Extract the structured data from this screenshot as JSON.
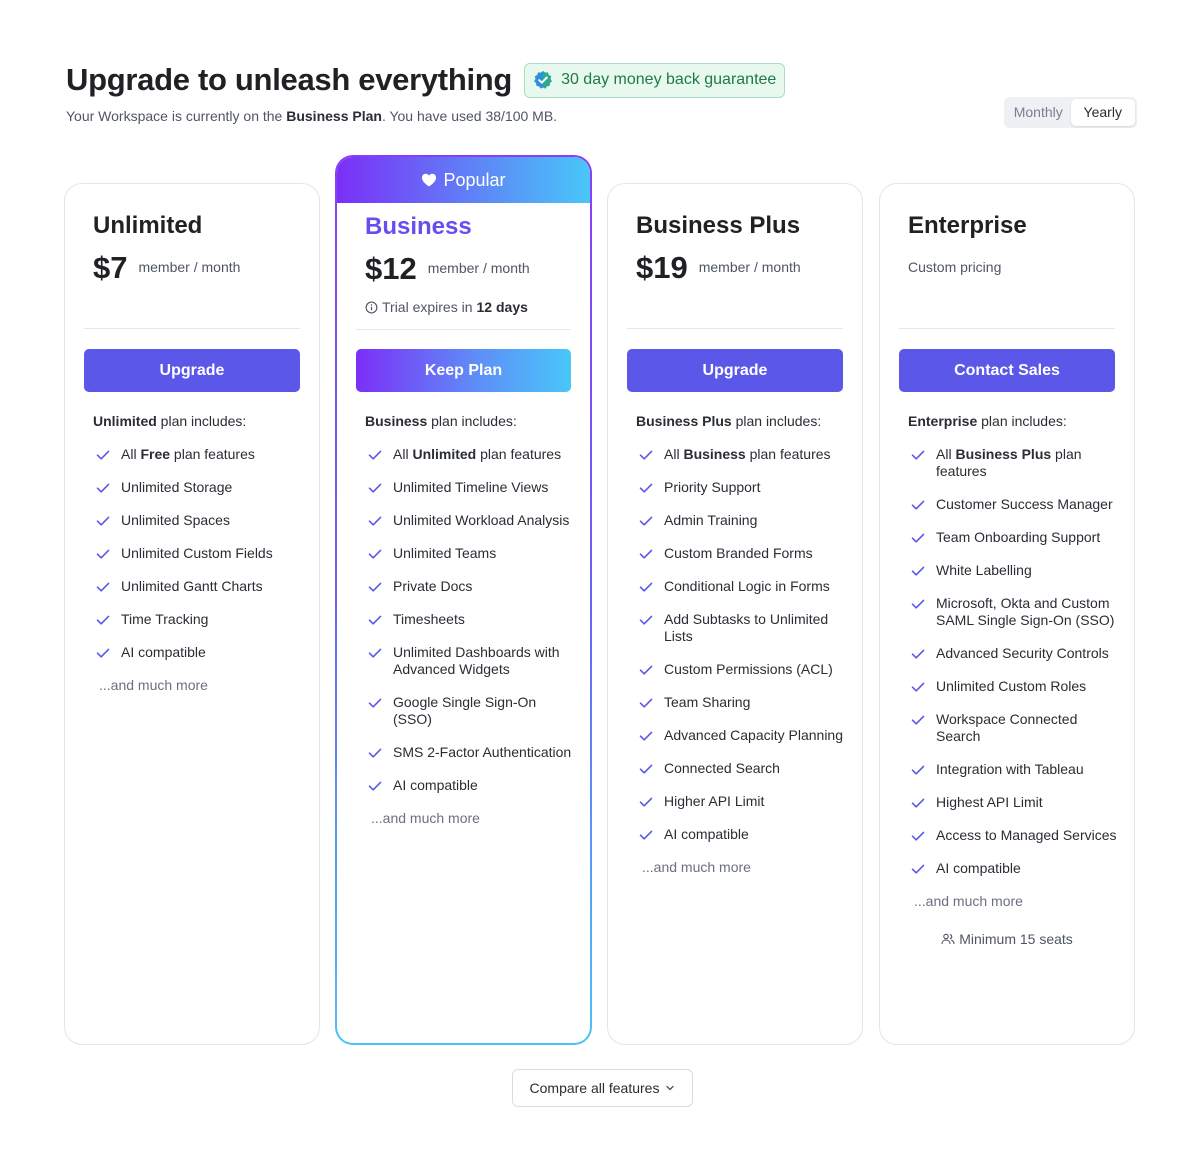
{
  "header": {
    "title": "Upgrade to unleash everything",
    "guarantee": "30 day money back guarantee",
    "subtitle_pre": "Your Workspace is currently on the ",
    "subtitle_plan": "Business Plan",
    "subtitle_post": ". You have used 38/100 MB."
  },
  "billing_toggle": {
    "monthly": "Monthly",
    "yearly": "Yearly",
    "selected": "Yearly"
  },
  "plans": [
    {
      "name": "Unlimited",
      "price": "$7",
      "per": "member / month",
      "button": "Upgrade",
      "includes_bold": "Unlimited",
      "includes_rest": " plan includes:",
      "features": [
        {
          "pre": "All ",
          "bold": "Free",
          "post": " plan features"
        },
        {
          "pre": "Unlimited Storage"
        },
        {
          "pre": "Unlimited Spaces"
        },
        {
          "pre": "Unlimited Custom Fields"
        },
        {
          "pre": "Unlimited Gantt Charts"
        },
        {
          "pre": "Time Tracking"
        },
        {
          "pre": "AI compatible"
        }
      ],
      "more": "...and much more"
    },
    {
      "name": "Business",
      "badge": "Popular",
      "price": "$12",
      "per": "member / month",
      "trial_pre": "Trial expires in",
      "trial_days": "12 days",
      "button": "Keep Plan",
      "includes_bold": "Business",
      "includes_rest": " plan includes:",
      "features": [
        {
          "pre": "All ",
          "bold": "Unlimited",
          "post": " plan features"
        },
        {
          "pre": "Unlimited Timeline Views"
        },
        {
          "pre": "Unlimited Workload Analysis"
        },
        {
          "pre": "Unlimited Teams"
        },
        {
          "pre": "Private Docs"
        },
        {
          "pre": "Timesheets"
        },
        {
          "pre": "Unlimited Dashboards with Advanced Widgets"
        },
        {
          "pre": "Google Single Sign-On (SSO)"
        },
        {
          "pre": "SMS 2-Factor Authentication"
        },
        {
          "pre": "AI compatible"
        }
      ],
      "more": "...and much more"
    },
    {
      "name": "Business Plus",
      "price": "$19",
      "per": "member / month",
      "button": "Upgrade",
      "includes_bold": "Business Plus",
      "includes_rest": " plan includes:",
      "features": [
        {
          "pre": "All ",
          "bold": "Business",
          "post": " plan features"
        },
        {
          "pre": "Priority Support"
        },
        {
          "pre": "Admin Training"
        },
        {
          "pre": "Custom Branded Forms"
        },
        {
          "pre": "Conditional Logic in Forms"
        },
        {
          "pre": "Add Subtasks to Unlimited Lists"
        },
        {
          "pre": "Custom Permissions (ACL)"
        },
        {
          "pre": "Team Sharing"
        },
        {
          "pre": "Advanced Capacity Planning"
        },
        {
          "pre": "Connected Search"
        },
        {
          "pre": "Higher API Limit"
        },
        {
          "pre": "AI compatible"
        }
      ],
      "more": "...and much more"
    },
    {
      "name": "Enterprise",
      "custom_pricing": "Custom pricing",
      "button": "Contact Sales",
      "includes_bold": "Enterprise",
      "includes_rest": " plan includes:",
      "features": [
        {
          "pre": "All ",
          "bold": "Business Plus",
          "post": " plan features"
        },
        {
          "pre": "Customer Success Manager"
        },
        {
          "pre": "Team Onboarding Support"
        },
        {
          "pre": "White Labelling"
        },
        {
          "pre": "Microsoft, Okta and Custom SAML Single Sign-On (SSO)"
        },
        {
          "pre": "Advanced Security Controls"
        },
        {
          "pre": "Unlimited Custom Roles"
        },
        {
          "pre": "Workspace Connected Search"
        },
        {
          "pre": "Integration with Tableau"
        },
        {
          "pre": "Highest API Limit"
        },
        {
          "pre": "Access to Managed Services"
        },
        {
          "pre": "AI compatible"
        }
      ],
      "more": "...and much more",
      "seats": "Minimum 15 seats"
    }
  ],
  "compare_button": "Compare all features",
  "colors": {
    "primary": "#5b57e8",
    "business_name": "#6a4cf0",
    "check": "#5b57e8",
    "guarantee_bg": "#e7f8ee",
    "guarantee_text": "#1f7a47"
  },
  "icons": {
    "guarantee": "verified-badge-icon",
    "popular": "heart-icon",
    "trial": "info-icon",
    "feature": "check-icon",
    "seats": "people-icon",
    "compare": "chevron-down-icon"
  }
}
